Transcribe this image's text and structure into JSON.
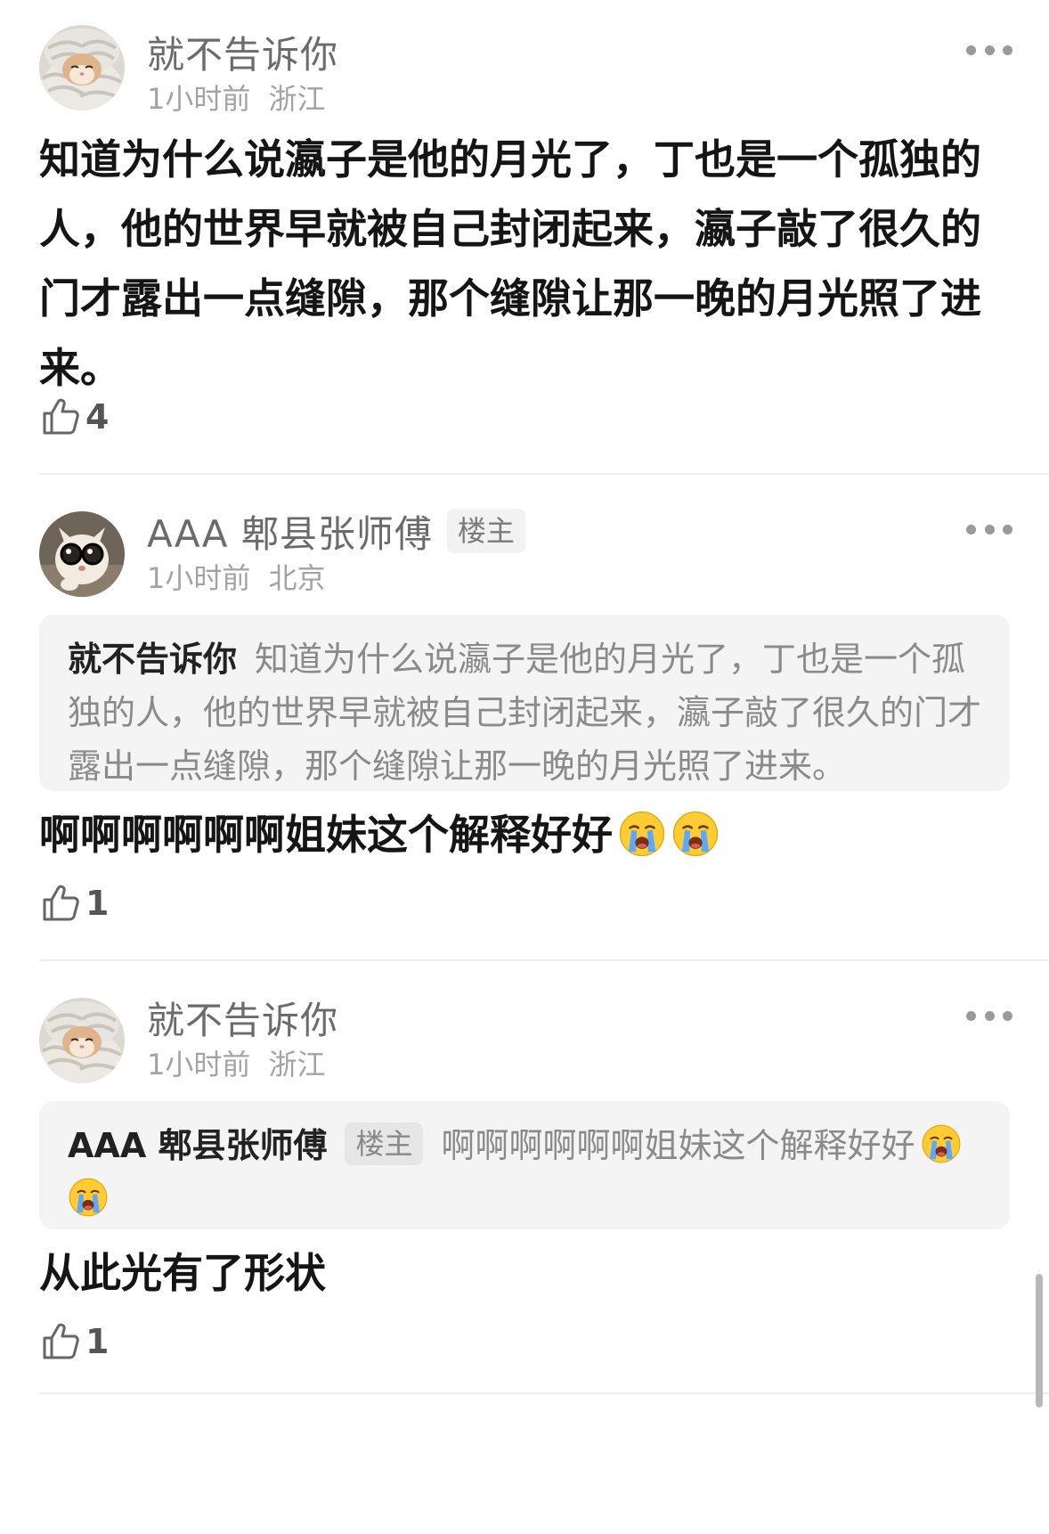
{
  "comments": [
    {
      "username": "就不告诉你",
      "time": "1小时前",
      "location": "浙江",
      "content": "知道为什么说瀛子是他的月光了，丁也是一个孤独的人，他的世界早就被自己封闭起来，瀛子敲了很久的门才露出一点缝隙，那个缝隙让那一晚的月光照了进来。",
      "likes": "4",
      "avatar_icon": "cat-in-scarf-avatar"
    },
    {
      "username": "AAA 郫县张师傅",
      "badge": "楼主",
      "time": "1小时前",
      "location": "北京",
      "quote_author": "就不告诉你",
      "quote_text": "知道为什么说瀛子是他的月光了，丁也是一个孤独的人，他的世界早就被自己封闭起来，瀛子敲了很久的门才露出一点缝隙，那个缝隙让那一晚的月光照了进来。",
      "content": "啊啊啊啊啊啊姐妹这个解释好好",
      "content_emojis": [
        "crying-face-emoji",
        "crying-face-emoji"
      ],
      "likes": "1",
      "avatar_icon": "dog-with-glasses-avatar"
    },
    {
      "username": "就不告诉你",
      "time": "1小时前",
      "location": "浙江",
      "quote_author": "AAA 郫县张师傅",
      "quote_badge": "楼主",
      "quote_text": "啊啊啊啊啊啊姐妹这个解释好好",
      "quote_emojis": [
        "crying-face-emoji",
        "crying-face-emoji"
      ],
      "content": "从此光有了形状",
      "likes": "1",
      "avatar_icon": "cat-in-scarf-avatar"
    }
  ],
  "icons": {
    "like": "thumbs-up-icon",
    "more": "more-dots-icon"
  },
  "colors": {
    "username": "#6b6b6b",
    "meta": "#a3a3a3",
    "content": "#151515",
    "quote_bg": "#f4f4f4",
    "badge_bg": "#f2f2f2"
  }
}
